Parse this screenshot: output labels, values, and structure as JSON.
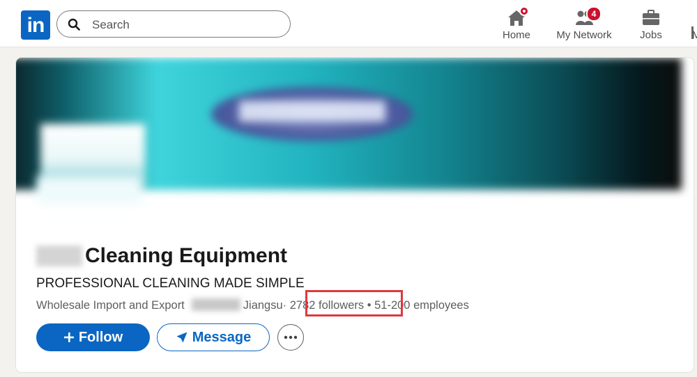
{
  "nav": {
    "logo_text": "in",
    "search_placeholder": "Search",
    "items": [
      {
        "label": "Home",
        "icon": "home-icon",
        "badge": ""
      },
      {
        "label": "My Network",
        "icon": "people-icon",
        "badge": "4"
      },
      {
        "label": "Jobs",
        "icon": "briefcase-icon",
        "badge": ""
      }
    ],
    "edge_letter": "M"
  },
  "company": {
    "name": "Cleaning Equipment",
    "tagline": "PROFESSIONAL CLEANING MADE SIMPLE",
    "industry": "Wholesale Import and Export",
    "location": "Jiangsu",
    "followers": "2782 followers",
    "employees": "51-200 employees"
  },
  "actions": {
    "follow_label": "Follow",
    "message_label": "Message"
  },
  "colors": {
    "brand": "#0a66c2",
    "badge": "#cb112d",
    "highlight": "#e0383e"
  }
}
